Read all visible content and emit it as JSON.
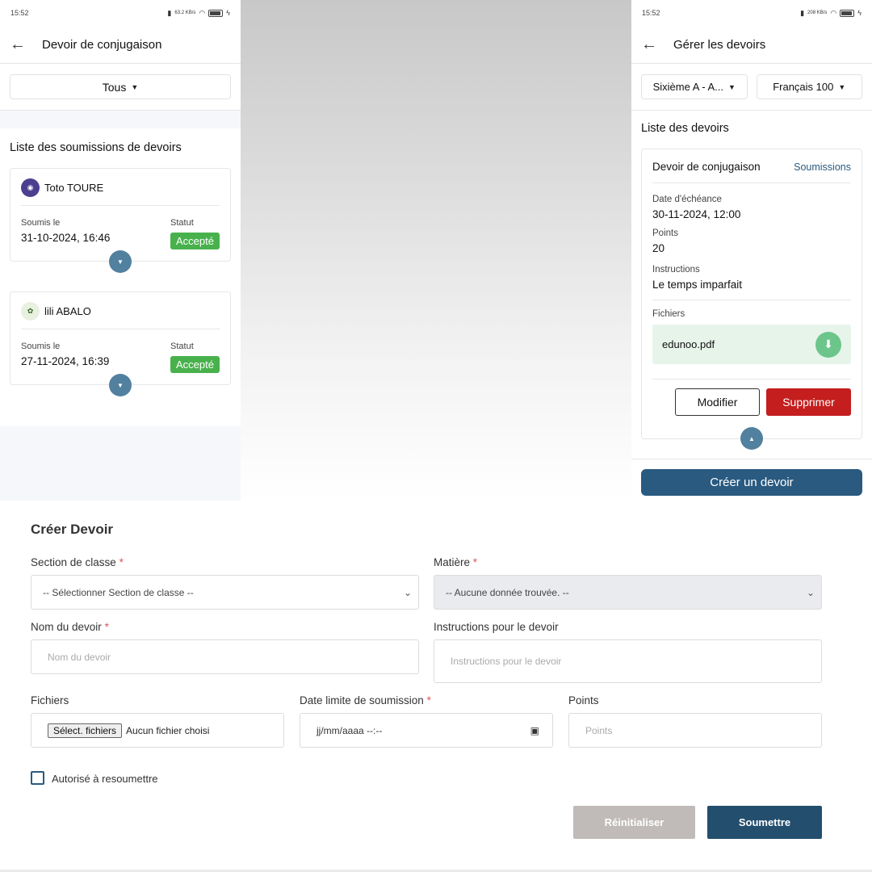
{
  "left_phone": {
    "status": {
      "time": "15:52",
      "net": "63.2 KB/s",
      "battery": "88"
    },
    "appbar": {
      "title": "Devoir de conjugaison"
    },
    "filter": {
      "selected": "Tous"
    },
    "list_title": "Liste des soumissions de devoirs",
    "submissions": [
      {
        "name": "Toto TOURE",
        "submitted_label": "Soumis le",
        "date": "31-10-2024, 16:46",
        "status_label": "Statut",
        "status": "Accepté"
      },
      {
        "name": "lili ABALO",
        "submitted_label": "Soumis le",
        "date": "27-11-2024, 16:39",
        "status_label": "Statut",
        "status": "Accepté"
      }
    ]
  },
  "right_phone": {
    "status": {
      "time": "15:52",
      "net": "208 KB/s",
      "battery": "88"
    },
    "appbar": {
      "title": "Gérer les devoirs"
    },
    "filters": {
      "class": "Sixième A - A...",
      "subject": "Français 100"
    },
    "list_title": "Liste des devoirs",
    "homework": {
      "title": "Devoir de conjugaison",
      "submissions_link": "Soumissions",
      "due_label": "Date d'échéance",
      "due": "30-11-2024, 12:00",
      "points_label": "Points",
      "points": "20",
      "instructions_label": "Instructions",
      "instructions": "Le temps imparfait",
      "files_label": "Fichiers",
      "file_name": "edunoo.pdf",
      "edit_label": "Modifier",
      "delete_label": "Supprimer"
    },
    "create_button": "Créer un devoir"
  },
  "web_form": {
    "title": "Créer Devoir",
    "class_section": {
      "label": "Section de classe",
      "value": "-- Sélectionner Section de classe --"
    },
    "subject": {
      "label": "Matière",
      "value": "-- Aucune donnée trouvée. --"
    },
    "name": {
      "label": "Nom du devoir",
      "placeholder": "Nom du devoir"
    },
    "instructions": {
      "label": "Instructions pour le devoir",
      "placeholder": "Instructions pour le devoir"
    },
    "files": {
      "label": "Fichiers",
      "button": "Sélect. fichiers",
      "status": "Aucun fichier choisi"
    },
    "deadline": {
      "label": "Date limite de soumission",
      "placeholder": "jj/mm/aaaa --:--"
    },
    "points": {
      "label": "Points",
      "placeholder": "Points"
    },
    "resubmit_label": "Autorisé à resoumettre",
    "reset_button": "Réinitialiser",
    "submit_button": "Soumettre"
  }
}
